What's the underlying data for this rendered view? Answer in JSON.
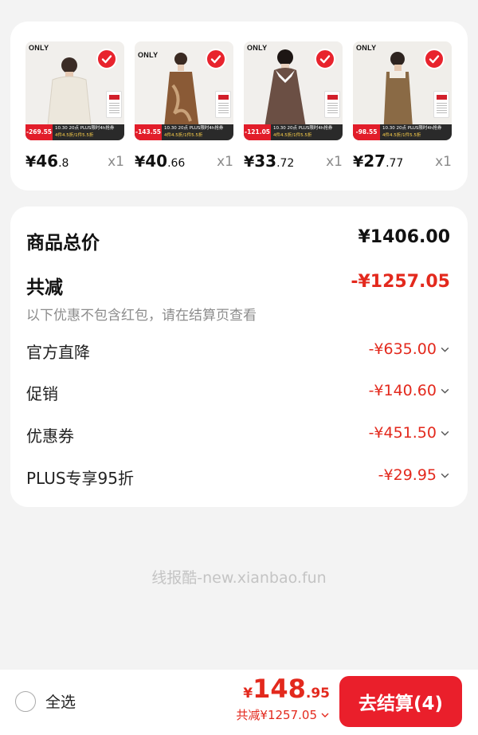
{
  "products": [
    {
      "brand": "ONLY",
      "promo_price": "-269.55",
      "promo_line1": "10.30 20点 PLUS限时4h抢券",
      "promo_line2": "4件4.5折/1件5.5折",
      "price_yuan": "¥",
      "price_int": "46",
      "price_dec": ".8",
      "qty": "x1",
      "dress_color": "#ece7dc",
      "bg": "#f1efec"
    },
    {
      "brand": "ONLY",
      "promo_price": "-143.55",
      "promo_line1": "10.30 20点 PLUS限时4h抢券",
      "promo_line2": "4件4.5折/1件5.5折",
      "price_yuan": "¥",
      "price_int": "40",
      "price_dec": ".66",
      "qty": "x1",
      "dress_color": "#8a5a36",
      "bg": "#f2f0ed"
    },
    {
      "brand": "ONLY",
      "promo_price": "-121.05",
      "promo_line1": "10.30 20点 PLUS限时4h抢券",
      "promo_line2": "4件4.5折/1件5.5折",
      "price_yuan": "¥",
      "price_int": "33",
      "price_dec": ".72",
      "qty": "x1",
      "dress_color": "#6b4f44",
      "bg": "#f1efec"
    },
    {
      "brand": "ONLY",
      "promo_price": "-98.55",
      "promo_line1": "10.30 20点 PLUS限时4h抢券",
      "promo_line2": "4件4.5折/1件5.5折",
      "price_yuan": "¥",
      "price_int": "27",
      "price_dec": ".77",
      "qty": "x1",
      "dress_color": "#8a6a45",
      "bg": "#f0eeea"
    }
  ],
  "summary": {
    "total_label": "商品总价",
    "total_value": "¥1406.00",
    "discount_label": "共减",
    "discount_value": "-¥1257.05",
    "discount_note": "以下优惠不包含红包，请在结算页查看",
    "items": [
      {
        "label": "官方直降",
        "value": "-¥635.00"
      },
      {
        "label": "促销",
        "value": "-¥140.60"
      },
      {
        "label": "优惠券",
        "value": "-¥451.50"
      },
      {
        "label": "PLUS专享95折",
        "value": "-¥29.95"
      }
    ]
  },
  "watermark": "线报酷-new.xianbao.fun",
  "bottom": {
    "select_all": "全选",
    "total_symbol": "¥",
    "total_int": "148",
    "total_dec": ".95",
    "total_discount": "共减¥1257.05",
    "checkout": "去结算(4)"
  },
  "colors": {
    "accent": "#e3291d",
    "button": "#ea1f2b"
  }
}
